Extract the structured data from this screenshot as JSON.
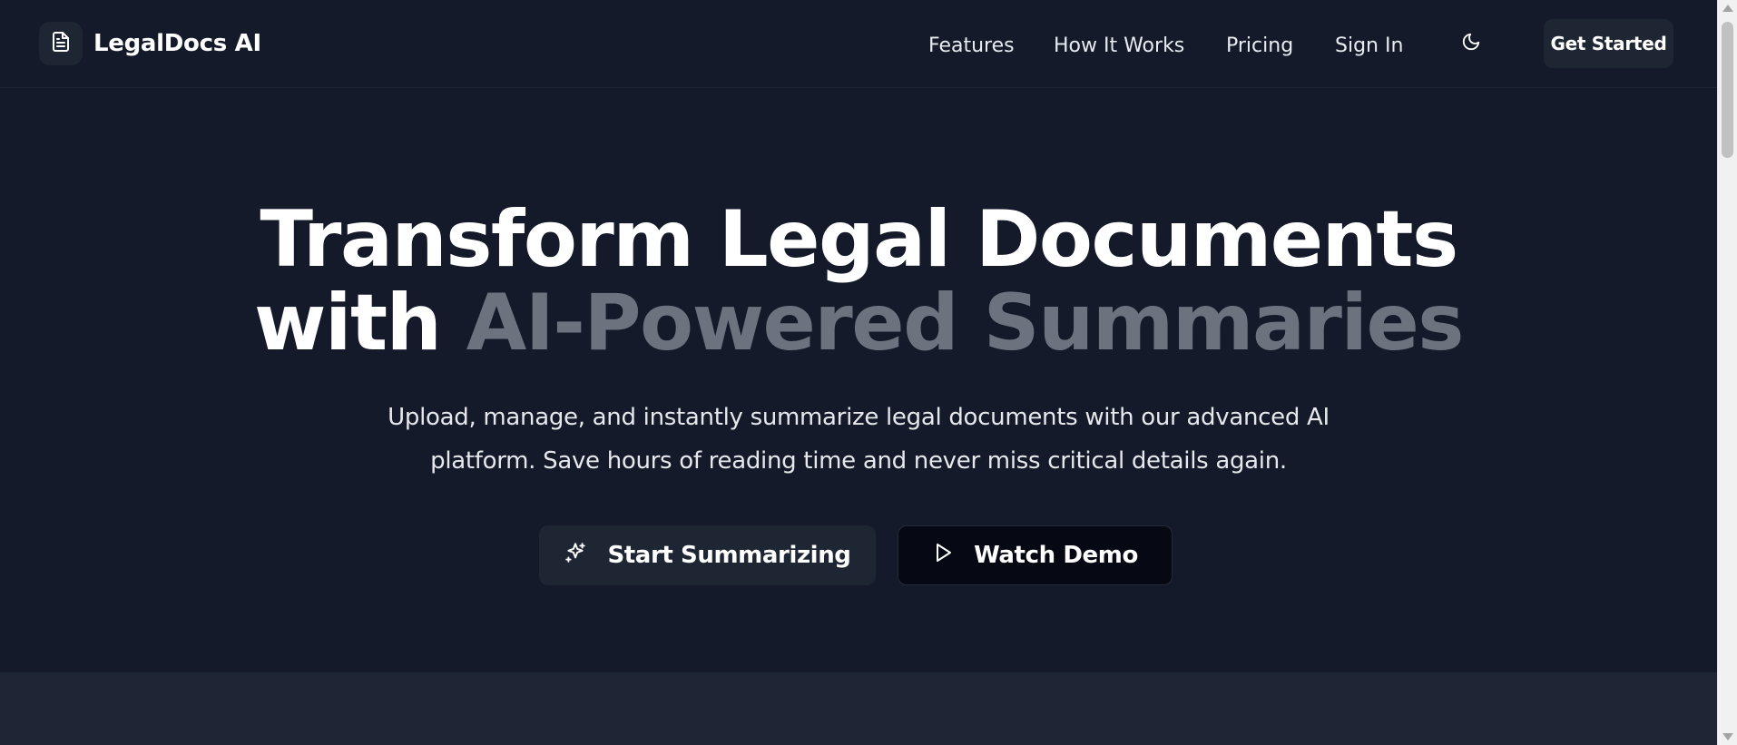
{
  "header": {
    "logo_text": "LegalDocs AI",
    "logo_icon": "file-text-icon",
    "nav": [
      {
        "label": "Features"
      },
      {
        "label": "How It Works"
      },
      {
        "label": "Pricing"
      },
      {
        "label": "Sign In"
      }
    ],
    "theme_toggle_icon": "moon-icon",
    "cta_label": "Get Started"
  },
  "hero": {
    "title_line1": "Transform Legal Documents",
    "title_line2_prefix": "with",
    "title_line2_accent": "AI-Powered Summaries",
    "subtitle_line1": "Upload, manage, and instantly summarize legal documents with our advanced AI",
    "subtitle_line2": "platform. Save hours of reading time and never miss critical details again.",
    "primary_cta": {
      "label": "Start Summarizing",
      "icon": "sparkles-icon"
    },
    "secondary_cta": {
      "label": "Watch Demo",
      "icon": "play-icon"
    }
  },
  "colors": {
    "background": "#141a29",
    "accent_text": "#6c727e",
    "button_dark": "#1e2533",
    "button_darker": "#060913",
    "section_alt": "#1e2635"
  }
}
